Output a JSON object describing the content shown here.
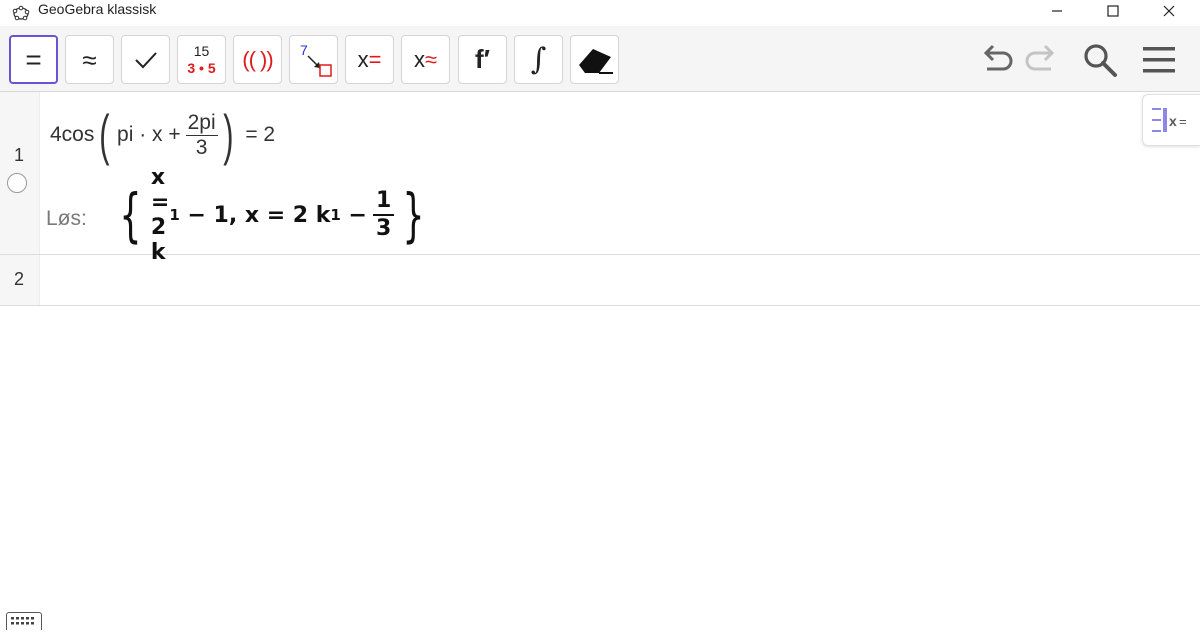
{
  "window": {
    "title": "GeoGebra klassisk",
    "minimize_icon": "minimize-icon",
    "maximize_icon": "maximize-icon",
    "close_icon": "close-icon"
  },
  "toolbar": {
    "tools": [
      {
        "name": "evaluate",
        "icon": "equals-icon",
        "label": "="
      },
      {
        "name": "numeric",
        "icon": "approx-icon",
        "label": "≈"
      },
      {
        "name": "check",
        "icon": "check-icon",
        "label": "✓"
      },
      {
        "name": "factor",
        "icon": "factor-icon",
        "top": "15",
        "bottom": "3 • 5"
      },
      {
        "name": "expand",
        "icon": "expand-icon",
        "label": "(( ))"
      },
      {
        "name": "substitute",
        "icon": "substitute-icon",
        "label": "7"
      },
      {
        "name": "solve",
        "icon": "solve-icon",
        "x": "x",
        "op": "="
      },
      {
        "name": "solve-numerically",
        "icon": "solve-numeric-icon",
        "x": "x",
        "op": "≈"
      },
      {
        "name": "derivative",
        "icon": "derivative-icon",
        "label": "f′"
      },
      {
        "name": "integral",
        "icon": "integral-icon",
        "label": "∫"
      },
      {
        "name": "delete",
        "icon": "eraser-icon"
      }
    ],
    "right": [
      "undo-icon",
      "redo-icon",
      "search-icon",
      "menu-icon"
    ]
  },
  "colors": {
    "accent": "#6557d2",
    "red": "#e01b1b",
    "blue": "#2336d8",
    "panel_accent": "#8e87e8"
  },
  "algebra": {
    "rows": [
      {
        "number": "1",
        "input": {
          "coef": "4cos",
          "inner_a": "pi · x +",
          "frac_num": "2pi",
          "frac_den": "3",
          "rhs": "= 2"
        },
        "solve_label": "Løs:",
        "solution": {
          "part1": "x = 2 k",
          "sub1": "1",
          "part2": " − 1, x = 2 k",
          "sub2": "1",
          "part3": " −",
          "frac_num": "1",
          "frac_den": "3"
        }
      },
      {
        "number": "2"
      }
    ],
    "panel_toggle_label": "x="
  }
}
